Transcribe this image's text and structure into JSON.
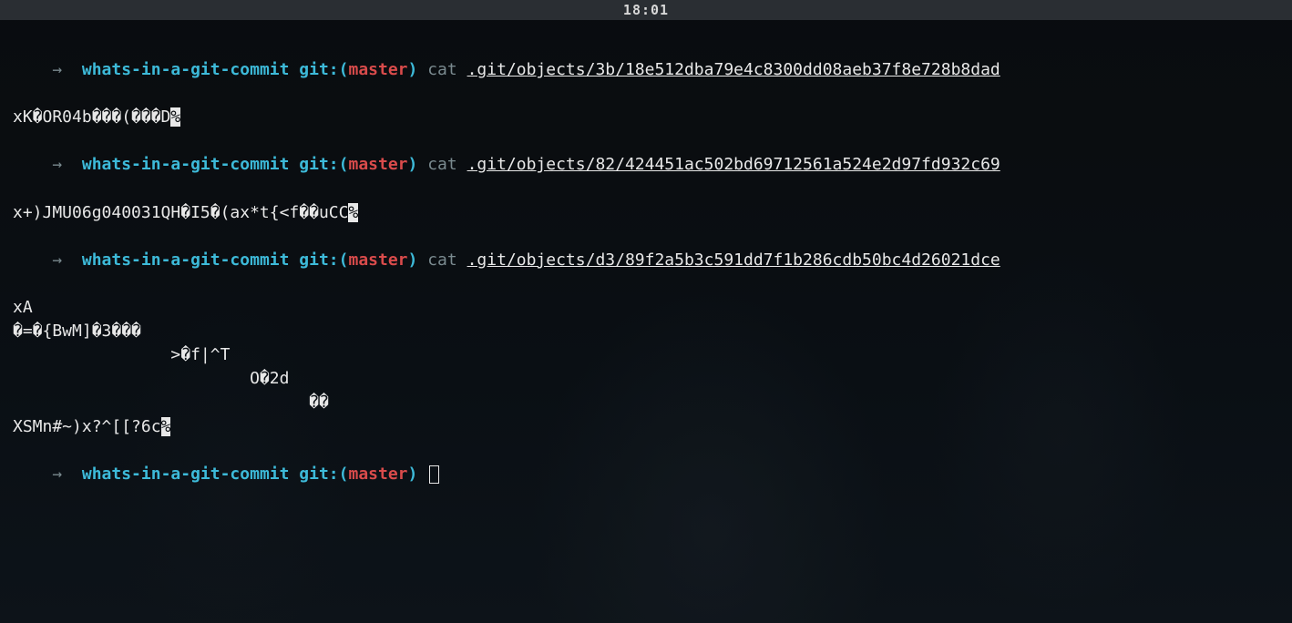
{
  "statusbar": {
    "time": "18:01"
  },
  "prompt": {
    "arrow": "→  ",
    "dir": "whats-in-a-git-commit",
    "git_label": " git:",
    "paren_open": "(",
    "branch": "master",
    "paren_close": ") "
  },
  "entries": [
    {
      "cmd": "cat ",
      "path": ".git/objects/3b/18e512dba79e4c8300dd08aeb37f8e728b8dad",
      "output_lines": [
        {
          "pre": "xK�OR04b���(���D",
          "rev": "%"
        }
      ]
    },
    {
      "cmd": "cat ",
      "path": ".git/objects/82/424451ac502bd69712561a524e2d97fd932c69",
      "output_lines": [
        {
          "pre": "x+)JMU06g040031QH�I5�(ax*t{<f��uCC",
          "rev": "%"
        }
      ]
    },
    {
      "cmd": "cat ",
      "path": ".git/objects/d3/89f2a5b3c591dd7f1b286cdb50bc4d26021dce",
      "output_lines": [
        {
          "pre": "xA"
        },
        {
          "pre": "�=�{BwM]�3���"
        },
        {
          "pre": "                >�f|^T"
        },
        {
          "pre": "                        O�2d"
        },
        {
          "pre": "                              ��"
        },
        {
          "pre": "XSMn#~)x?^[[?6c",
          "rev": "%"
        }
      ]
    }
  ],
  "cursor_prompt": true
}
